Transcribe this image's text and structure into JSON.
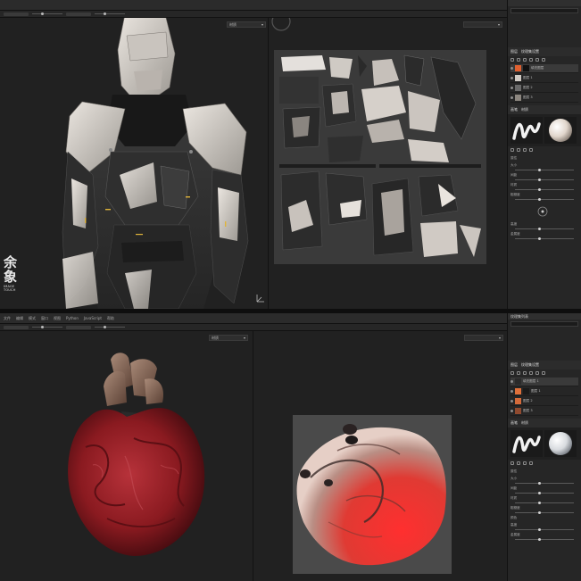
{
  "top_window": {
    "menu": [
      "",
      "",
      "",
      "",
      "",
      "",
      "",
      ""
    ],
    "viewport3d_dropdown": "材质",
    "uvview_dropdown": "",
    "panel": {
      "header_title": "",
      "header_right": "",
      "tabs": [
        "图层",
        "纹理集设置"
      ],
      "layer_names": [
        "填充图层",
        "图层 1",
        "图层 2",
        "图层 3"
      ],
      "preview_tabs": [
        "画笔",
        "材质"
      ],
      "prop_labels": [
        "属性",
        "大小",
        "间距",
        "材质",
        "粗糙度",
        "高度",
        "金属度"
      ]
    }
  },
  "bottom_window": {
    "menu": [
      "文件",
      "编辑",
      "模式",
      "窗口",
      "视图",
      "Python",
      "JavaScript",
      "帮助"
    ],
    "viewport3d_dropdown": "材质",
    "uvview_dropdown": "",
    "panel": {
      "header_title": "纹理集列表",
      "header_right": "",
      "tabs": [
        "图层",
        "纹理集设置"
      ],
      "layer_names": [
        "填充图层 1",
        "图层 1",
        "图层 2",
        "图层 3"
      ],
      "preview_tabs": [
        "画笔",
        "材质"
      ],
      "prop_labels": [
        "属性",
        "大小",
        "间距",
        "材质",
        "粗糙度",
        "颜色",
        "高度",
        "金属度"
      ]
    }
  },
  "logo": {
    "chars": [
      "余",
      "象"
    ],
    "tagline": "IMAGE TOUCH"
  },
  "colors": {
    "panel_bg": "#262626",
    "viewport_bg": "#212121",
    "uv_tile_bg": "#3a3a3a",
    "heart_red": "#8e1c22",
    "armor_white": "#d7d2cc"
  }
}
